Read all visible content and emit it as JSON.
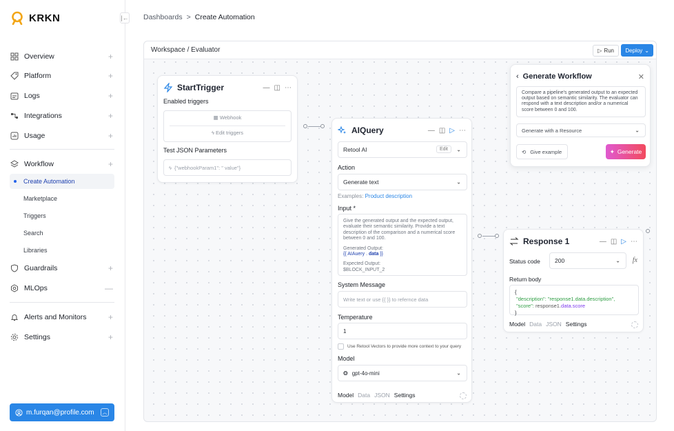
{
  "app": {
    "name": "KRKN",
    "brand_color": "#f2a516",
    "accent": "#2a86e6"
  },
  "sidebar": {
    "collapse_icon": "collapse-left-icon",
    "items": [
      {
        "label": "Overview",
        "icon": "grid-icon"
      },
      {
        "label": "Platform",
        "icon": "tag-icon"
      },
      {
        "label": "Logs",
        "icon": "logs-icon"
      },
      {
        "label": "Integrations",
        "icon": "integrations-icon"
      },
      {
        "label": "Usage",
        "icon": "usage-icon"
      },
      {
        "label": "Workflow",
        "icon": "layers-icon"
      },
      {
        "label": "Guardrails",
        "icon": "shield-icon"
      },
      {
        "label": "MLOps",
        "icon": "mlops-icon"
      },
      {
        "label": "Alerts and Monitors",
        "icon": "bell-icon"
      },
      {
        "label": "Settings",
        "icon": "gear-icon"
      }
    ],
    "workflow_sub": [
      "Create Automation",
      "Marketplace",
      "Triggers",
      "Search",
      "Libraries"
    ],
    "user_email": "m.furqan@profile.com"
  },
  "breadcrumb": {
    "parent": "Dashboards",
    "separator": ">",
    "current": "Create Automation"
  },
  "canvas": {
    "title": "Workspace / Evaluator",
    "run_label": "Run",
    "deploy_label": "Deploy"
  },
  "start_trigger": {
    "title": "StartTrigger",
    "enabled_label": "Enabled triggers",
    "webhook_label": "Webhook",
    "edit_label": "Edit triggers",
    "params_label": "Test JSON Parameters",
    "params_placeholder": "{\"webhookParam1\": \" value\"}"
  },
  "ai_query": {
    "title": "AIQuery",
    "resource": "Retool AI",
    "edit_label": "Edit",
    "action_label": "Action",
    "action_value": "Generate text",
    "examples_prefix": "Examples:",
    "examples_link": "Product description",
    "input_label": "Input *",
    "input_text": "Give the generated output and the expected output, evaluate their semantic similarity. Provide a text description of the comparison and a numerical score between 0 and 100.",
    "generated_output_label": "Generated Output:",
    "generated_output_open": "{{ AIAuery .",
    "generated_output_data": "data",
    "generated_output_close": "}}",
    "expected_output_label": "Expected Output:",
    "expected_output_value": "$BLOCK_INPUT_2",
    "system_label": "System Message",
    "system_placeholder": "Write text or use {{ }} to refernce data",
    "temperature_label": "Temperature",
    "temperature_value": "1",
    "vectors_label": "Use Retool Vectors to provide more context to your query",
    "model_label": "Model",
    "model_value": "gpt-4o-mini",
    "tabs": [
      "Model",
      "Data",
      "JSON",
      "Settings"
    ]
  },
  "response": {
    "title": "Response 1",
    "status_label": "Status code",
    "status_value": "200",
    "fx_label": "fx",
    "return_label": "Return body",
    "body_open": "{",
    "body_desc_key": "\"description\":",
    "body_desc_val": "\"response1.data.description\",",
    "body_score_key": "\"score\":",
    "body_score_val_a": "response1.",
    "body_score_val_b": "data.score",
    "body_close": "}",
    "tabs": [
      "Model",
      "Data",
      "JSON",
      "Settings"
    ]
  },
  "generate_workflow": {
    "title": "Generate Workflow",
    "description": "Compare a pipeline's generated output to an expected output based on semantic similarity. The evaluator can respond with a text description and/or a numerical score between 0 and 100.",
    "resource_select": "Generate with a Resource",
    "example_label": "Give example",
    "generate_label": "Generate"
  }
}
